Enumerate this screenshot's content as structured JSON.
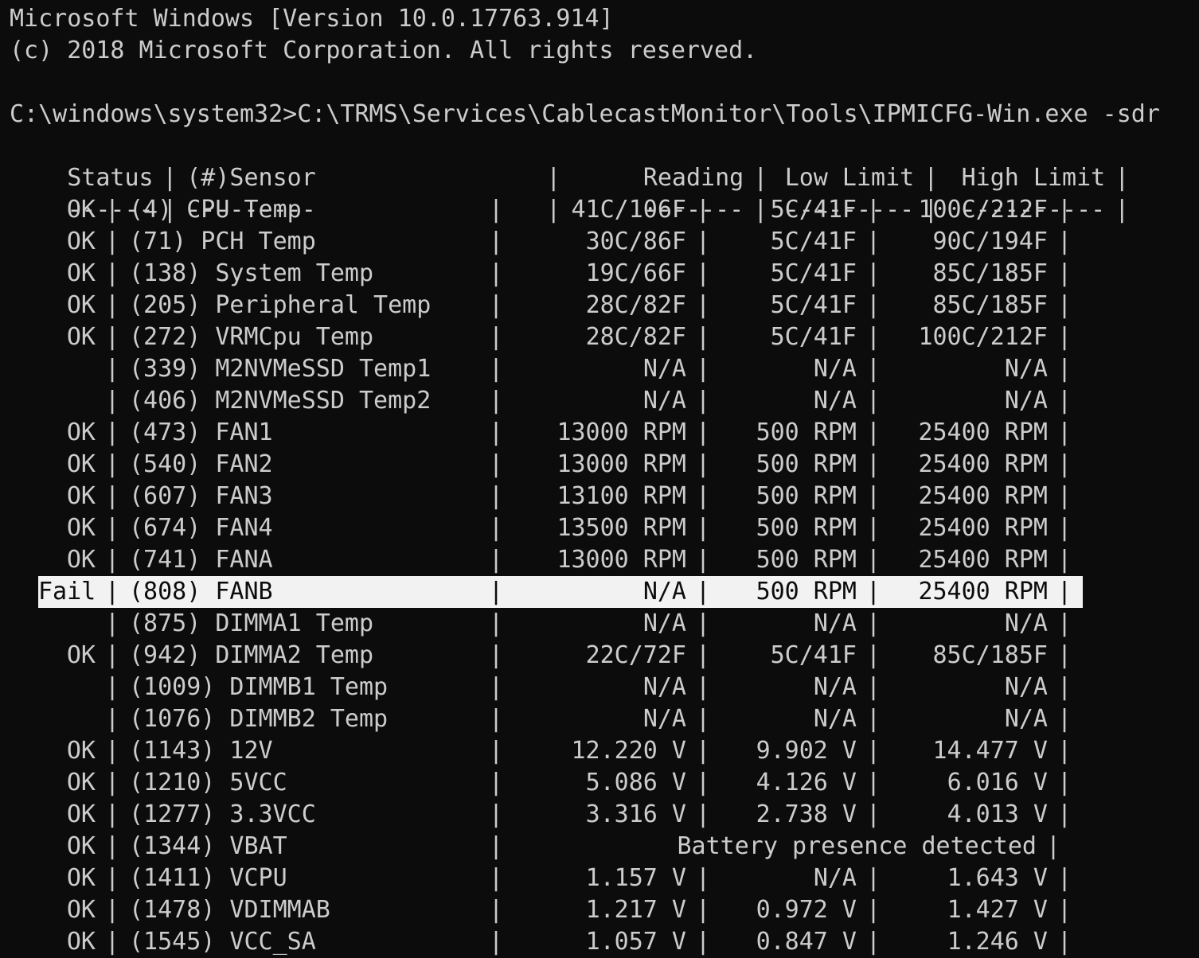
{
  "header": {
    "line1": "Microsoft Windows [Version 10.0.17763.914]",
    "line2": "(c) 2018 Microsoft Corporation. All rights reserved.",
    "command": "C:\\windows\\system32>C:\\TRMS\\Services\\CablecastMonitor\\Tools\\IPMICFG-Win.exe -sdr"
  },
  "table": {
    "columns": {
      "status": "Status",
      "sensor": "(#)Sensor",
      "reading": "Reading",
      "low": "Low Limit",
      "high": "High Limit"
    },
    "dashes": {
      "status": "------",
      "sensor": "---------",
      "reading": "-------",
      "low": "---------",
      "high": "----------"
    },
    "separator": "|",
    "rows": [
      {
        "status": "OK",
        "sensor": "(4) CPU Temp",
        "reading": "41C/106F",
        "low": "5C/41F",
        "high": "100C/212F"
      },
      {
        "status": "OK",
        "sensor": "(71) PCH Temp",
        "reading": "30C/86F",
        "low": "5C/41F",
        "high": "90C/194F"
      },
      {
        "status": "OK",
        "sensor": "(138) System Temp",
        "reading": "19C/66F",
        "low": "5C/41F",
        "high": "85C/185F"
      },
      {
        "status": "OK",
        "sensor": "(205) Peripheral Temp",
        "reading": "28C/82F",
        "low": "5C/41F",
        "high": "85C/185F"
      },
      {
        "status": "OK",
        "sensor": "(272) VRMCpu Temp",
        "reading": "28C/82F",
        "low": "5C/41F",
        "high": "100C/212F"
      },
      {
        "status": "",
        "sensor": "(339) M2NVMeSSD Temp1",
        "reading": "N/A",
        "low": "N/A",
        "high": "N/A"
      },
      {
        "status": "",
        "sensor": "(406) M2NVMeSSD Temp2",
        "reading": "N/A",
        "low": "N/A",
        "high": "N/A"
      },
      {
        "status": "OK",
        "sensor": "(473) FAN1",
        "reading": "13000 RPM",
        "low": "500 RPM",
        "high": "25400 RPM"
      },
      {
        "status": "OK",
        "sensor": "(540) FAN2",
        "reading": "13000 RPM",
        "low": "500 RPM",
        "high": "25400 RPM"
      },
      {
        "status": "OK",
        "sensor": "(607) FAN3",
        "reading": "13100 RPM",
        "low": "500 RPM",
        "high": "25400 RPM"
      },
      {
        "status": "OK",
        "sensor": "(674) FAN4",
        "reading": "13500 RPM",
        "low": "500 RPM",
        "high": "25400 RPM"
      },
      {
        "status": "OK",
        "sensor": "(741) FANA",
        "reading": "13000 RPM",
        "low": "500 RPM",
        "high": "25400 RPM"
      },
      {
        "status": "Fail",
        "sensor": "(808) FANB",
        "reading": "N/A",
        "low": "500 RPM",
        "high": "25400 RPM",
        "selected": true
      },
      {
        "status": "",
        "sensor": "(875) DIMMA1 Temp",
        "reading": "N/A",
        "low": "N/A",
        "high": "N/A"
      },
      {
        "status": "OK",
        "sensor": "(942) DIMMA2 Temp",
        "reading": "22C/72F",
        "low": "5C/41F",
        "high": "85C/185F"
      },
      {
        "status": "",
        "sensor": "(1009) DIMMB1 Temp",
        "reading": "N/A",
        "low": "N/A",
        "high": "N/A"
      },
      {
        "status": "",
        "sensor": "(1076) DIMMB2 Temp",
        "reading": "N/A",
        "low": "N/A",
        "high": "N/A"
      },
      {
        "status": "OK",
        "sensor": "(1143) 12V",
        "reading": "12.220 V",
        "low": "9.902 V",
        "high": "14.477 V"
      },
      {
        "status": "OK",
        "sensor": "(1210) 5VCC",
        "reading": "5.086 V",
        "low": "4.126 V",
        "high": "6.016 V"
      },
      {
        "status": "OK",
        "sensor": "(1277) 3.3VCC",
        "reading": "3.316 V",
        "low": "2.738 V",
        "high": "4.013 V"
      },
      {
        "status": "OK",
        "sensor": "(1344) VBAT",
        "note": "Battery presence detected"
      },
      {
        "status": "OK",
        "sensor": "(1411) VCPU",
        "reading": "1.157 V",
        "low": "N/A",
        "high": "1.643 V"
      },
      {
        "status": "OK",
        "sensor": "(1478) VDIMMAB",
        "reading": "1.217 V",
        "low": "0.972 V",
        "high": "1.427 V"
      },
      {
        "status": "OK",
        "sensor": "(1545) VCC_SA",
        "reading": "1.057 V",
        "low": "0.847 V",
        "high": "1.246 V"
      }
    ]
  },
  "colors": {
    "background": "#0c0c0c",
    "text": "#cccccc",
    "selection_bg": "#f2f2f2",
    "selection_text": "#0c0c0c"
  }
}
